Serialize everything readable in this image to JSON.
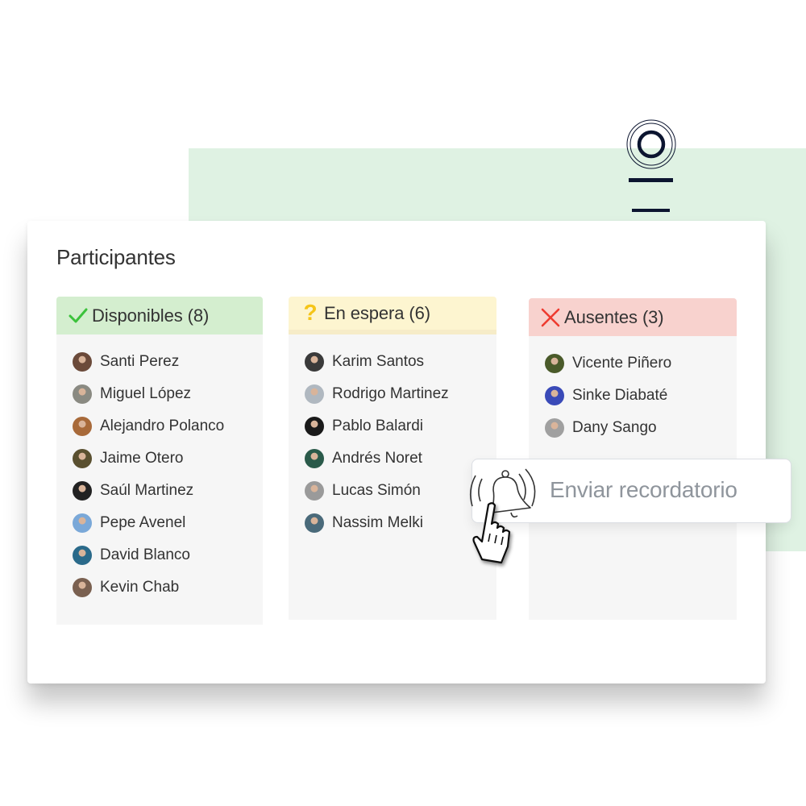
{
  "panel": {
    "title": "Participantes"
  },
  "columns": [
    {
      "status": "available",
      "icon": "check-icon",
      "label": "Disponibles (8)",
      "color": "#d4eecf",
      "icon_color": "#3cc23c",
      "people": [
        {
          "name": "Santi Perez",
          "avatar_color": "#6b4a3a"
        },
        {
          "name": "Miguel López",
          "avatar_color": "#8a8a82"
        },
        {
          "name": "Alejandro Polanco",
          "avatar_color": "#a86a3a"
        },
        {
          "name": "Jaime Otero",
          "avatar_color": "#5a5030"
        },
        {
          "name": "Saúl Martinez",
          "avatar_color": "#222222"
        },
        {
          "name": "Pepe Avenel",
          "avatar_color": "#7aa8d8"
        },
        {
          "name": "David Blanco",
          "avatar_color": "#2a6a8a"
        },
        {
          "name": "Kevin Chab",
          "avatar_color": "#7a6050"
        }
      ]
    },
    {
      "status": "pending",
      "icon": "question-icon",
      "label": "En espera (6)",
      "color": "#fdf5d0",
      "icon_color": "#f5c518",
      "people": [
        {
          "name": "Karim Santos",
          "avatar_color": "#3a3a3a"
        },
        {
          "name": "Rodrigo Martinez",
          "avatar_color": "#b0b8c0"
        },
        {
          "name": "Pablo Balardi",
          "avatar_color": "#1a1a1a"
        },
        {
          "name": "Andrés Noret",
          "avatar_color": "#2a5a4a"
        },
        {
          "name": "Lucas Simón",
          "avatar_color": "#9a9a9a"
        },
        {
          "name": "Nassim Melki",
          "avatar_color": "#4a6a7a"
        }
      ]
    },
    {
      "status": "absent",
      "icon": "x-icon",
      "label": "Ausentes (3)",
      "color": "#f8d2ce",
      "icon_color": "#ee3b30",
      "people": [
        {
          "name": "Vicente Piñero",
          "avatar_color": "#4a5a2a"
        },
        {
          "name": "Sinke Diabaté",
          "avatar_color": "#3a4ab8"
        },
        {
          "name": "Dany Sango",
          "avatar_color": "#a0a0a0"
        }
      ]
    }
  ],
  "reminder": {
    "label": "Enviar recordatorio",
    "icon": "bell-ringing-icon"
  },
  "brand": {
    "logo": "logo-icon",
    "color": "#0c1530",
    "background_accent": "#dff2e3"
  }
}
